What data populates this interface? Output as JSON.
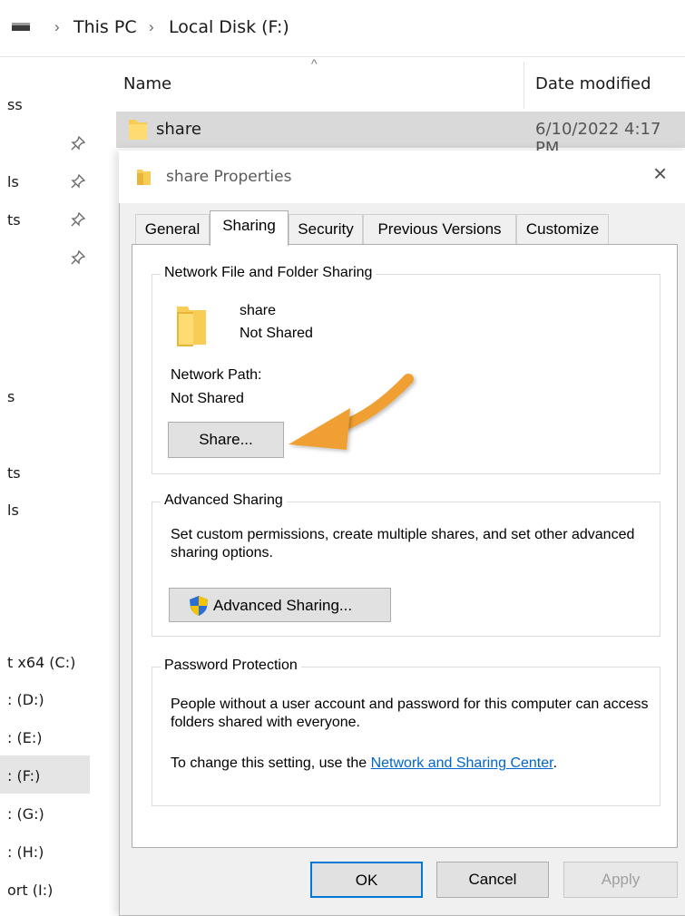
{
  "explorer": {
    "breadcrumb": [
      "This PC",
      "Local Disk (F:)"
    ],
    "nav_items": [
      "ss",
      "ls",
      "ts",
      "s",
      "ts",
      "ls",
      "t x64 (C:)",
      ": (D:)",
      ": (E:)",
      ": (F:)",
      ": (G:)",
      ": (H:)",
      "ort (I:)"
    ],
    "columns": {
      "name": "Name",
      "date": "Date modified"
    },
    "rows": [
      {
        "name": "share",
        "date": "6/10/2022 4:17 PM"
      }
    ]
  },
  "dialog": {
    "title": "share Properties",
    "tabs": [
      "General",
      "Sharing",
      "Security",
      "Previous Versions",
      "Customize"
    ],
    "active_tab": "Sharing",
    "network_group": {
      "legend": "Network File and Folder Sharing",
      "folder_name": "share",
      "status": "Not Shared",
      "path_label": "Network Path:",
      "path_value": "Not Shared",
      "share_button": "Share..."
    },
    "advanced_group": {
      "legend": "Advanced Sharing",
      "description": "Set custom permissions, create multiple shares, and set other advanced sharing options.",
      "button": "Advanced Sharing..."
    },
    "password_group": {
      "legend": "Password Protection",
      "description": "People without a user account and password for this computer can access folders shared with everyone.",
      "setting_prefix": "To change this setting, use the ",
      "link": "Network and Sharing Center",
      "setting_suffix": "."
    },
    "buttons": {
      "ok": "OK",
      "cancel": "Cancel",
      "apply": "Apply"
    }
  },
  "colors": {
    "arrow": "#f0a030",
    "folder": "#f8cd55",
    "link": "#0066cc",
    "shield_blue": "#2b6fd6",
    "shield_yellow": "#f5c400"
  },
  "icons": [
    "drive-icon",
    "pin-icon",
    "folder-icon",
    "close-icon",
    "shield-icon",
    "arrow-annotation"
  ]
}
